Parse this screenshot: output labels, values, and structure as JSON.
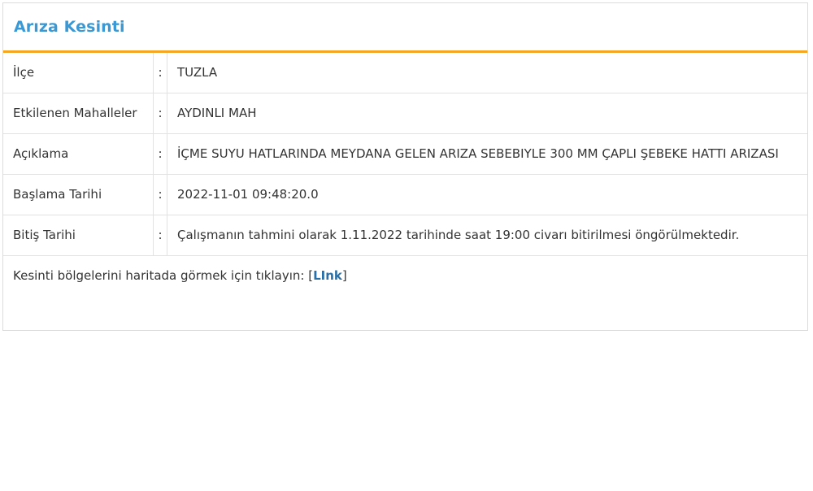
{
  "panel": {
    "title": "Arıza Kesinti"
  },
  "rows": [
    {
      "label": "İlçe",
      "sep": ":",
      "value": "TUZLA"
    },
    {
      "label": "Etkilenen Mahalleler",
      "sep": ":",
      "value": "AYDINLI MAH"
    },
    {
      "label": "Açıklama",
      "sep": ":",
      "value": "İÇME SUYU HATLARINDA MEYDANA GELEN ARIZA SEBEBIYLE 300 MM ÇAPLI ŞEBEKE HATTI ARIZASI"
    },
    {
      "label": "Başlama Tarihi",
      "sep": ":",
      "value": "2022-11-01 09:48:20.0"
    },
    {
      "label": "Bitiş Tarihi",
      "sep": ":",
      "value": "Çalışmanın tahmini olarak 1.11.2022 tarihinde saat 19:00 civarı bitirilmesi öngörülmektedir."
    }
  ],
  "footer": {
    "text": "Kesinti bölgelerini haritada görmek için tıklayın: ",
    "bracket_open": "[",
    "link_label": "LInk",
    "bracket_close": "]"
  },
  "colors": {
    "title": "#3a98d4",
    "header_underline": "#f5a623",
    "link": "#2a6fa8"
  }
}
